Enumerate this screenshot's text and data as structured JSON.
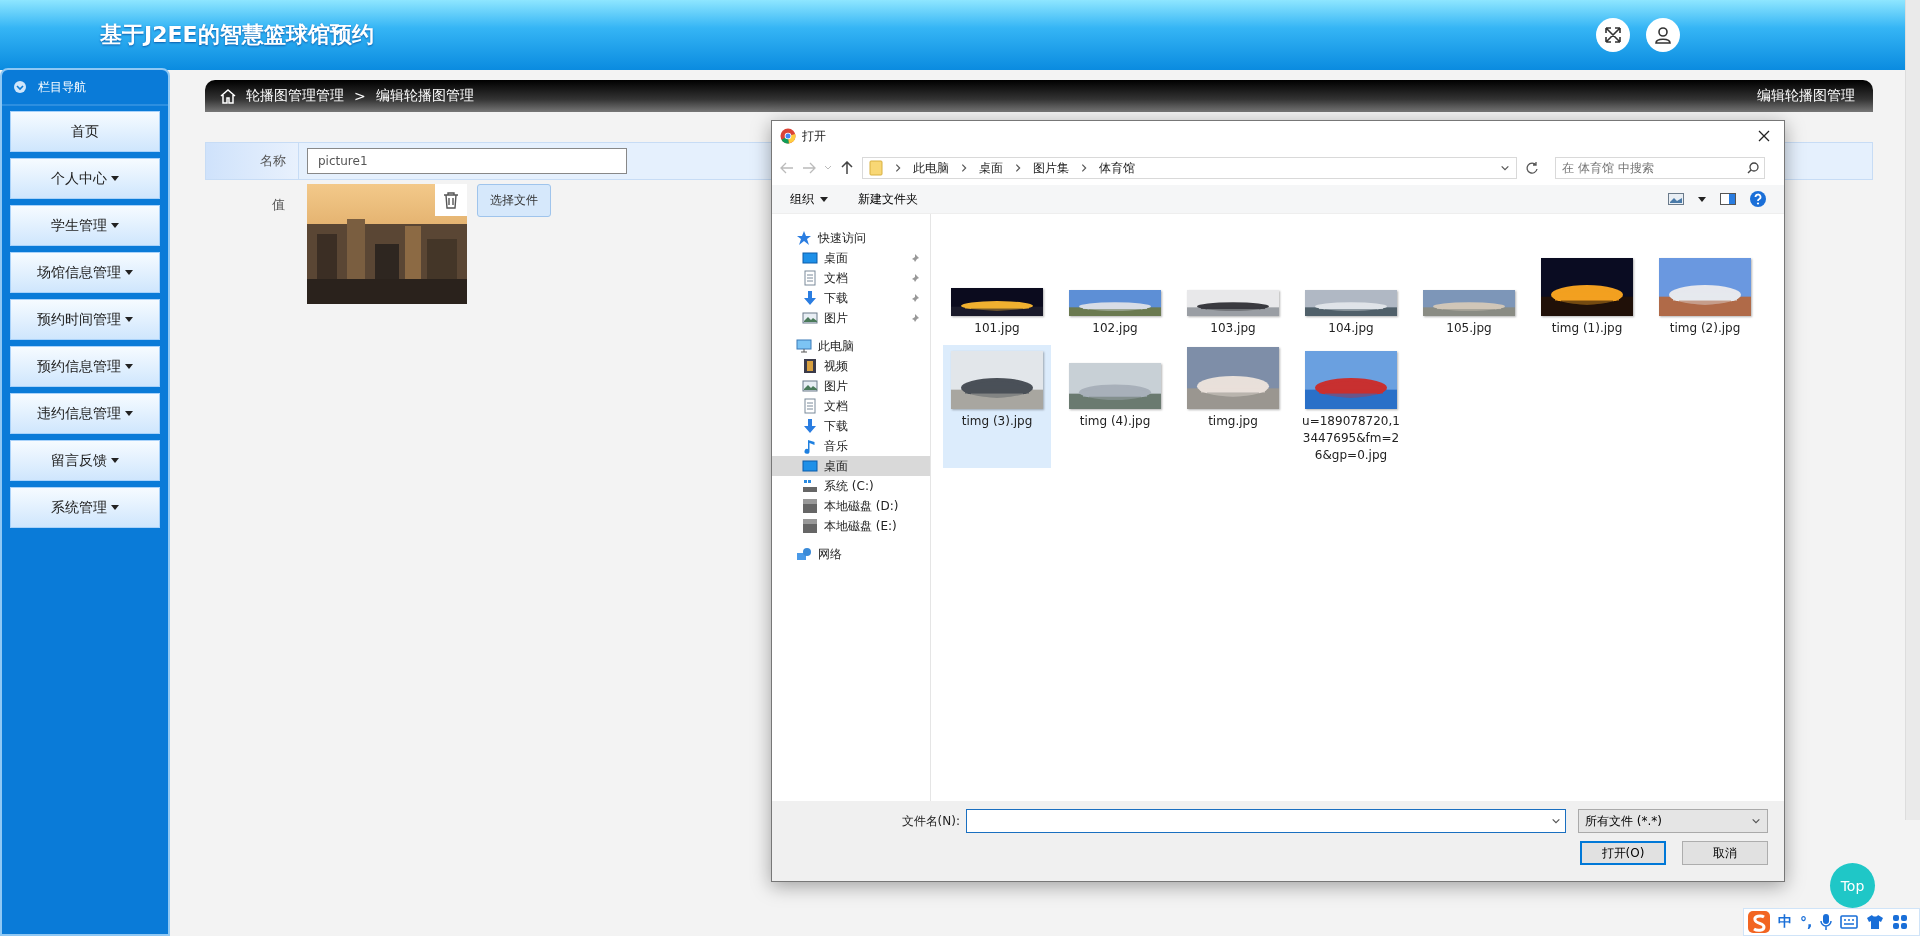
{
  "header": {
    "title": "基于J2EE的智慧篮球馆预约"
  },
  "sidebar": {
    "title": "栏目导航",
    "items": [
      {
        "label": "首页",
        "dropdown": false
      },
      {
        "label": "个人中心",
        "dropdown": true
      },
      {
        "label": "学生管理",
        "dropdown": true
      },
      {
        "label": "场馆信息管理",
        "dropdown": true
      },
      {
        "label": "预约时间管理",
        "dropdown": true
      },
      {
        "label": "预约信息管理",
        "dropdown": true
      },
      {
        "label": "违约信息管理",
        "dropdown": true
      },
      {
        "label": "留言反馈",
        "dropdown": true
      },
      {
        "label": "系统管理",
        "dropdown": true
      }
    ]
  },
  "breadcrumb": {
    "items": [
      "轮播图管理管理",
      "编辑轮播图管理"
    ],
    "separator": ">",
    "page_title": "编辑轮播图管理"
  },
  "form": {
    "name_label": "名称",
    "name_value": "picture1",
    "value_label": "值",
    "choose_button": "选择文件"
  },
  "dialog": {
    "title": "打开",
    "path": [
      "此电脑",
      "桌面",
      "图片集",
      "体育馆"
    ],
    "search_placeholder": "在 体育馆 中搜索",
    "toolbar": {
      "organize": "组织",
      "new_folder": "新建文件夹"
    },
    "nav": [
      {
        "label": "快速访问",
        "kind": "quick-access",
        "selected": false,
        "children": [
          {
            "label": "桌面",
            "kind": "desktop",
            "pinned": true,
            "selected": false
          },
          {
            "label": "文档",
            "kind": "document",
            "pinned": true,
            "selected": false
          },
          {
            "label": "下载",
            "kind": "download",
            "pinned": true,
            "selected": false
          },
          {
            "label": "图片",
            "kind": "pictures",
            "pinned": true,
            "selected": false
          }
        ]
      },
      {
        "label": "此电脑",
        "kind": "pc",
        "selected": false,
        "children": [
          {
            "label": "视频",
            "kind": "video",
            "pinned": false,
            "selected": false
          },
          {
            "label": "图片",
            "kind": "pictures",
            "pinned": false,
            "selected": false
          },
          {
            "label": "文档",
            "kind": "document",
            "pinned": false,
            "selected": false
          },
          {
            "label": "下载",
            "kind": "download",
            "pinned": false,
            "selected": false
          },
          {
            "label": "音乐",
            "kind": "music",
            "pinned": false,
            "selected": false
          },
          {
            "label": "桌面",
            "kind": "desktop",
            "pinned": false,
            "selected": true
          },
          {
            "label": "系统 (C:)",
            "kind": "system-drive",
            "pinned": false,
            "selected": false
          },
          {
            "label": "本地磁盘 (D:)",
            "kind": "drive",
            "pinned": false,
            "selected": false
          },
          {
            "label": "本地磁盘 (E:)",
            "kind": "drive",
            "pinned": false,
            "selected": false
          }
        ]
      },
      {
        "label": "网络",
        "kind": "network",
        "selected": false
      }
    ],
    "files": [
      {
        "name": "101.jpg",
        "selected": false
      },
      {
        "name": "102.jpg",
        "selected": false
      },
      {
        "name": "103.jpg",
        "selected": false
      },
      {
        "name": "104.jpg",
        "selected": false
      },
      {
        "name": "105.jpg",
        "selected": false
      },
      {
        "name": "timg (1).jpg",
        "selected": false
      },
      {
        "name": "timg (2).jpg",
        "selected": false
      },
      {
        "name": "timg (3).jpg",
        "selected": true
      },
      {
        "name": "timg (4).jpg",
        "selected": false
      },
      {
        "name": "timg.jpg",
        "selected": false
      },
      {
        "name": "u=189078720,13447695&fm=26&gp=0.jpg",
        "selected": false
      }
    ],
    "filename_label": "文件名(N):",
    "filter": "所有文件 (*.*)",
    "open_button": "打开(O)",
    "cancel_button": "取消"
  },
  "top_button": "Top",
  "ime": {
    "mode": "中",
    "punct": "°,"
  }
}
